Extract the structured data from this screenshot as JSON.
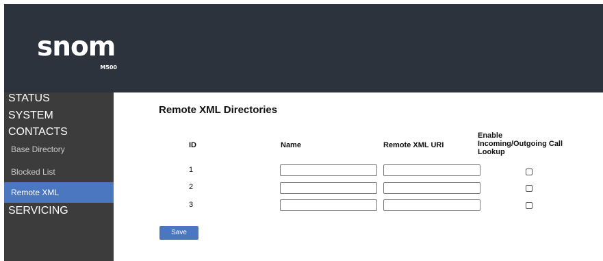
{
  "header": {
    "logo_text": "snom",
    "model": "M500"
  },
  "nav": {
    "main": [
      "STATUS",
      "SYSTEM",
      "CONTACTS"
    ],
    "sub": [
      "Base Directory",
      "Blocked List",
      "Remote XML"
    ],
    "active_sub": "Remote XML",
    "after": "SERVICING"
  },
  "main": {
    "title": "Remote XML Directories",
    "columns": {
      "id": "ID",
      "name": "Name",
      "uri": "Remote XML URI",
      "lookup": [
        "Enable",
        "Incoming/Outgoing Call",
        "Lookup"
      ]
    },
    "rows": [
      {
        "id": "1",
        "name": "",
        "uri": "",
        "lookup_enabled": false
      },
      {
        "id": "2",
        "name": "",
        "uri": "",
        "lookup_enabled": false
      },
      {
        "id": "3",
        "name": "",
        "uri": "",
        "lookup_enabled": false
      }
    ],
    "save_label": "Save"
  },
  "colors": {
    "header_bg": "#2d333d",
    "sidebar_bg": "#3c3c3c",
    "accent": "#4b77c1"
  }
}
